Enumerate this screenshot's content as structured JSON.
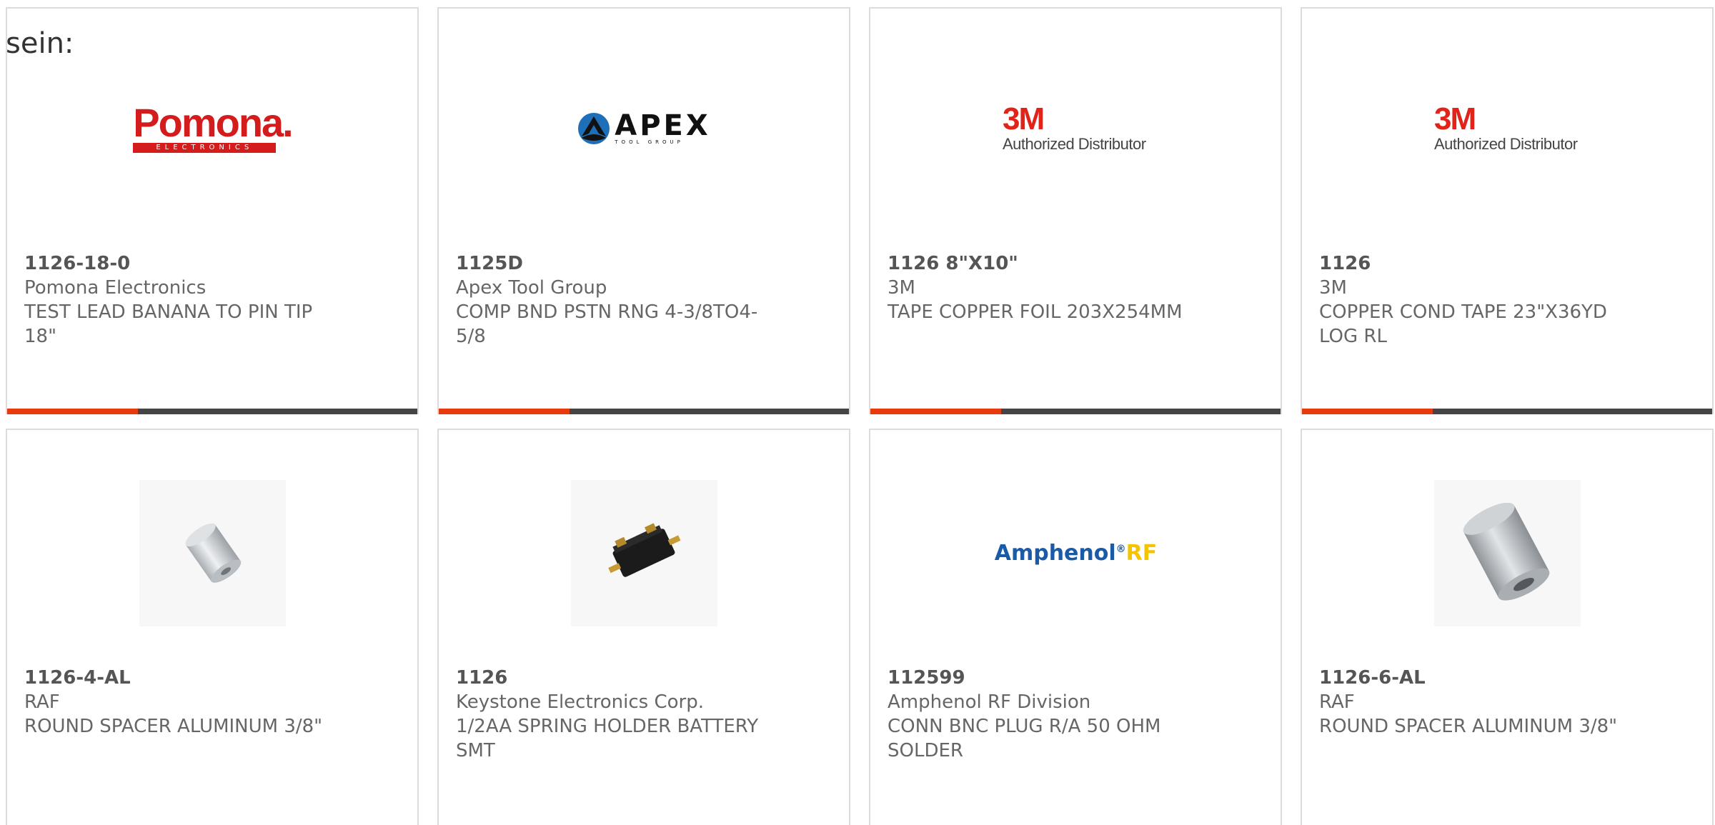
{
  "intro_text": "sein:",
  "products": [
    {
      "part": "1126-18-0",
      "maker": "Pomona Electronics",
      "desc": "TEST LEAD BANANA TO PIN TIP 18\"",
      "logo": {
        "kind": "pomona",
        "word": "Pomona.",
        "sub": "ELECTRONICS",
        "color": "#d41c1c"
      }
    },
    {
      "part": "1125D",
      "maker": "Apex Tool Group",
      "desc": "COMP BND PSTN RNG 4-3/8TO4-5/8",
      "logo": {
        "kind": "apex",
        "word": "APEX",
        "sub": "TOOL GROUP"
      }
    },
    {
      "part": "1126 8\"X10\"",
      "maker": "3M",
      "desc": "TAPE COPPER FOIL 203X254MM",
      "logo": {
        "kind": "3m",
        "word": "3M",
        "sub": "Authorized Distributor",
        "color": "#e2231a"
      }
    },
    {
      "part": "1126",
      "maker": "3M",
      "desc": "COPPER COND TAPE 23\"X36YD LOG RL",
      "logo": {
        "kind": "3m",
        "word": "3M",
        "sub": "Authorized Distributor",
        "color": "#e2231a"
      }
    },
    {
      "part": "1126-4-AL",
      "maker": "RAF",
      "desc": "ROUND SPACER ALUMINUM 3/8\"",
      "image": "round-spacer-small-photo"
    },
    {
      "part": "1126",
      "maker": "Keystone Electronics Corp.",
      "desc": "1/2AA SPRING HOLDER BATTERY SMT",
      "image": "battery-holder-photo"
    },
    {
      "part": "112599",
      "maker": "Amphenol RF Division",
      "desc": "CONN BNC PLUG R/A 50 OHM SOLDER",
      "logo": {
        "kind": "amphenol",
        "word": "Amphenol",
        "mark": "®",
        "rf": "RF",
        "color": "#1a5aa6",
        "rf_color": "#f5c400"
      }
    },
    {
      "part": "1126-6-AL",
      "maker": "RAF",
      "desc": "ROUND SPACER ALUMINUM 3/8\"",
      "image": "round-spacer-large-photo"
    }
  ],
  "colors": {
    "accent": "#e8380d",
    "bar": "#444444",
    "border": "#dcdcdc"
  }
}
